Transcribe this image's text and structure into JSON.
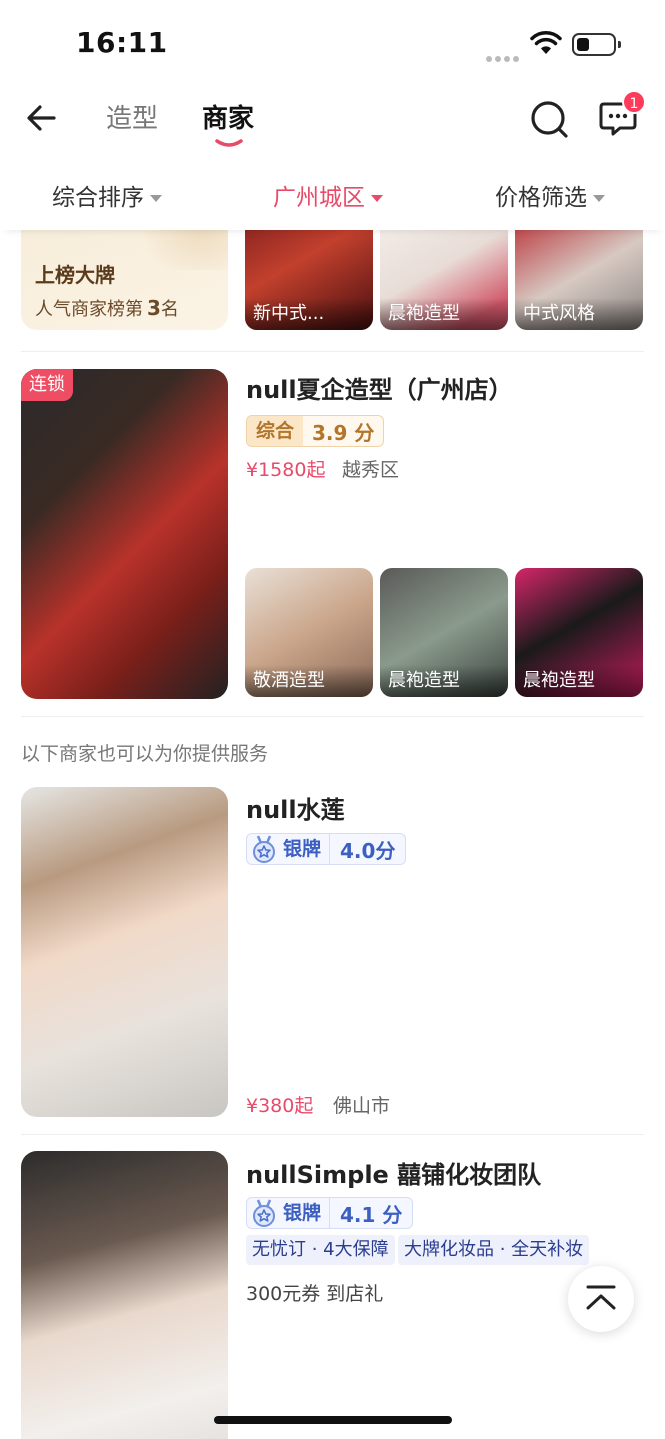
{
  "status_bar": {
    "time": "16:11"
  },
  "nav": {
    "tabs": [
      {
        "label": "造型",
        "active": false
      },
      {
        "label": "商家",
        "active": true
      }
    ],
    "message_badge": "1"
  },
  "filters": [
    {
      "label": "综合排序",
      "active": false
    },
    {
      "label": "广州城区",
      "active": true
    },
    {
      "label": "价格筛选",
      "active": false
    }
  ],
  "ranking_card": {
    "title": "上榜大牌",
    "subtitle": "人气商家榜第",
    "rank": "3",
    "rank_suffix": "名",
    "thumbnails": [
      {
        "caption": "新中式..."
      },
      {
        "caption": "晨袍造型"
      },
      {
        "caption": "中式风格"
      }
    ]
  },
  "shops": [
    {
      "tag": "连锁",
      "name": "null夏企造型（广州店）",
      "rating_label": "综合",
      "score": "3.9",
      "score_unit": "分",
      "price": "¥1580起",
      "area": "越秀区",
      "thumbnails": [
        {
          "caption": "敬酒造型"
        },
        {
          "caption": "晨袍造型"
        },
        {
          "caption": "晨袍造型"
        }
      ]
    }
  ],
  "section_label": "以下商家也可以为你提供服务",
  "more_shops": [
    {
      "name": "null水莲",
      "rating_label": "银牌",
      "score": "4.0",
      "score_unit": "分",
      "price": "¥380起",
      "area": "佛山市"
    },
    {
      "name": "nullSimple 囍铺化妆团队",
      "rating_label": "银牌",
      "score": "4.1",
      "score_unit": "分",
      "promos": [
        "无忧订 · 4大保障",
        "大牌化妆品 · 全天补妆"
      ],
      "coupon": "300元券 到店礼"
    }
  ],
  "colors": {
    "accent": "#e84a6a",
    "gold": "#b3752a",
    "silver_blue": "#3c5fc0"
  }
}
